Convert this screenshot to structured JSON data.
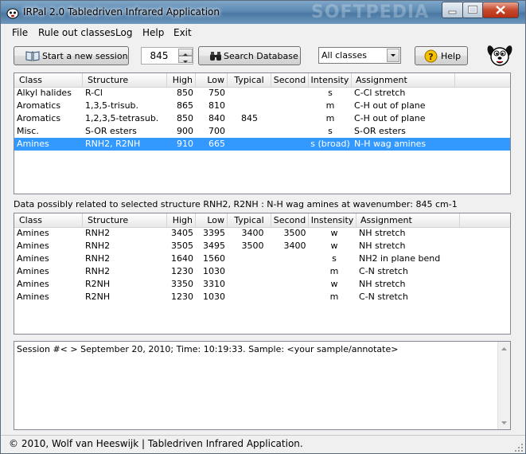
{
  "window": {
    "title": "IRPal 2.0  Tabledriven Infrared Application",
    "watermark": "SOFTPEDIA"
  },
  "menu": [
    "File",
    "Rule out classes",
    "Log",
    "Help",
    "Exit"
  ],
  "toolbar": {
    "start_session_label": "Start a new session",
    "wavenumber_value": "845",
    "search_label": "Search Database",
    "class_filter_value": "All classes",
    "help_label": "Help"
  },
  "columns_top": [
    "Class",
    "Structure",
    "High",
    "Low",
    "Typical",
    "Second",
    "Intensity",
    "Assignment"
  ],
  "rows_top": [
    {
      "class": "Alkyl halides",
      "structure": "R-Cl",
      "high": "850",
      "low": "750",
      "typical": "",
      "second": "",
      "intensity": "s",
      "assignment": "C-Cl stretch"
    },
    {
      "class": "Aromatics",
      "structure": "1,3,5-trisub.",
      "high": "865",
      "low": "810",
      "typical": "",
      "second": "",
      "intensity": "m",
      "assignment": "C-H out of plane"
    },
    {
      "class": "Aromatics",
      "structure": "1,2,3,5-tetrasub.",
      "high": "850",
      "low": "840",
      "typical": "845",
      "second": "",
      "intensity": "m",
      "assignment": "C-H out of plane"
    },
    {
      "class": "Misc.",
      "structure": "S-OR esters",
      "high": "900",
      "low": "700",
      "typical": "",
      "second": "",
      "intensity": "s",
      "assignment": "S-OR esters"
    },
    {
      "class": "Amines",
      "structure": "RNH2, R2NH",
      "high": "910",
      "low": "665",
      "typical": "",
      "second": "",
      "intensity": "s (broad)",
      "assignment": "N-H wag amines"
    }
  ],
  "caption": "Data possibly related to selected structure  RNH2, R2NH :   N-H wag amines at wavenumber: 845 cm-1",
  "columns_bottom": [
    "Class",
    "Structure",
    "High",
    "Low",
    "Typical",
    "Second",
    "Instensity",
    "Assignment"
  ],
  "rows_bottom": [
    {
      "class": "Amines",
      "structure": "RNH2",
      "high": "3405",
      "low": "3395",
      "typical": "3400",
      "second": "3500",
      "intensity": "w",
      "assignment": "NH stretch"
    },
    {
      "class": "Amines",
      "structure": "RNH2",
      "high": "3505",
      "low": "3495",
      "typical": "3500",
      "second": "3400",
      "intensity": "w",
      "assignment": "NH stretch"
    },
    {
      "class": "Amines",
      "structure": "RNH2",
      "high": "1640",
      "low": "1560",
      "typical": "",
      "second": "",
      "intensity": "s",
      "assignment": "NH2 in plane bend"
    },
    {
      "class": "Amines",
      "structure": "RNH2",
      "high": "1230",
      "low": "1030",
      "typical": "",
      "second": "",
      "intensity": "m",
      "assignment": "C-N stretch"
    },
    {
      "class": "Amines",
      "structure": "R2NH",
      "high": "3350",
      "low": "3310",
      "typical": "",
      "second": "",
      "intensity": "w",
      "assignment": "NH stretch"
    },
    {
      "class": "Amines",
      "structure": "R2NH",
      "high": "1230",
      "low": "1030",
      "typical": "",
      "second": "",
      "intensity": "m",
      "assignment": "C-N stretch"
    }
  ],
  "memo_text": "Session #< >  September 20, 2010;  Time: 10:19:33.  Sample: <your sample/annotate>",
  "status_text": "© 2010, Wolf van Heeswijk  |  Tabledriven Infrared Application.",
  "colors": {
    "selection": "#3399ff",
    "titlebar": "#5d8ab3"
  },
  "icons": [
    "app-icon",
    "book-icon",
    "binoculars-icon",
    "help-icon",
    "mascot-icon"
  ]
}
